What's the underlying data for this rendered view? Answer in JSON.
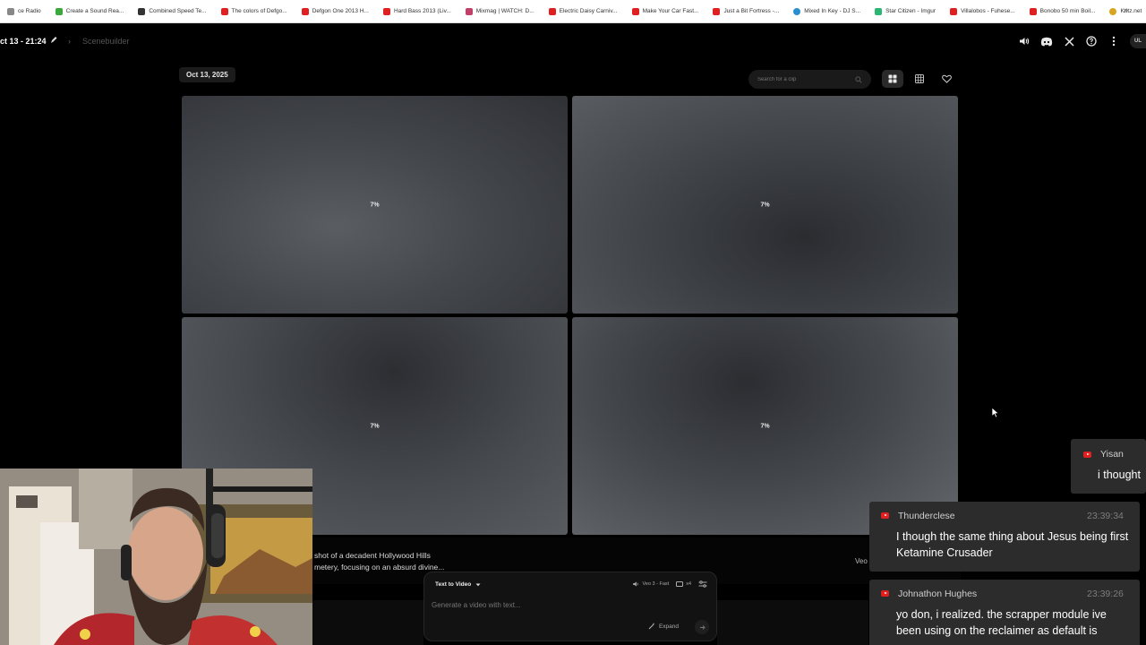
{
  "bookmarks": [
    {
      "label": "ce Radio",
      "color": "#888888"
    },
    {
      "label": "Create a Sound Rea...",
      "color": "#3aa83a"
    },
    {
      "label": "Combined Speed Te...",
      "color": "#333333"
    },
    {
      "label": "The colors of Defgo...",
      "color": "#e02020"
    },
    {
      "label": "Defgon One 2013 H...",
      "color": "#e02020"
    },
    {
      "label": "Hard Bass 2013 (Liv...",
      "color": "#e02020"
    },
    {
      "label": "Mixmag | WATCH: D...",
      "color": "#c0406a"
    },
    {
      "label": "Electric Daisy Carniv...",
      "color": "#e02020"
    },
    {
      "label": "Make Your Car Fast...",
      "color": "#e02020"
    },
    {
      "label": "Just a Bit Fortress -...",
      "color": "#e02020"
    },
    {
      "label": "Mixed In Key - DJ S...",
      "color": "#2a8fd0"
    },
    {
      "label": "Star Citizen - Imgur",
      "color": "#2bb673"
    },
    {
      "label": "Villalobos - Fuhese...",
      "color": "#e02020"
    },
    {
      "label": "Bonobo 50 min Boil...",
      "color": "#e02020"
    },
    {
      "label": "Kritz.net",
      "color": "#d9a520"
    }
  ],
  "bookmarks_more": "»",
  "header": {
    "project_title": "ct 13 - 21:24",
    "breadcrumb": "Scenebuilder",
    "avatar_text": "UL"
  },
  "main": {
    "date_label": "Oct 13, 2025",
    "search_placeholder": "Search for a clip",
    "tiles": [
      {
        "progress": "7%"
      },
      {
        "progress": "7%"
      },
      {
        "progress": "7%"
      },
      {
        "progress": "7%"
      }
    ],
    "prompt_line_1": "shot of a decadent Hollywood Hills",
    "prompt_line_2": "metery, focusing on an absurd divine...",
    "model_tag": "Veo"
  },
  "composer": {
    "mode_label": "Text to Video",
    "model_label": "Veo 3 - Fast",
    "count_label": "x4",
    "input_placeholder": "Generate a video with text...",
    "expand_label": "Expand"
  },
  "chat": [
    {
      "author": "Yisan",
      "time": "",
      "message": "i thought"
    },
    {
      "author": "Thunderclese",
      "time": "23:39:34",
      "message": "I though the same thing about Jesus being first Ketamine Crusader"
    },
    {
      "author": "Johnathon Hughes",
      "time": "23:39:26",
      "message": "yo don, i realized. the scrapper module ive been using on the reclaimer as default is"
    }
  ]
}
